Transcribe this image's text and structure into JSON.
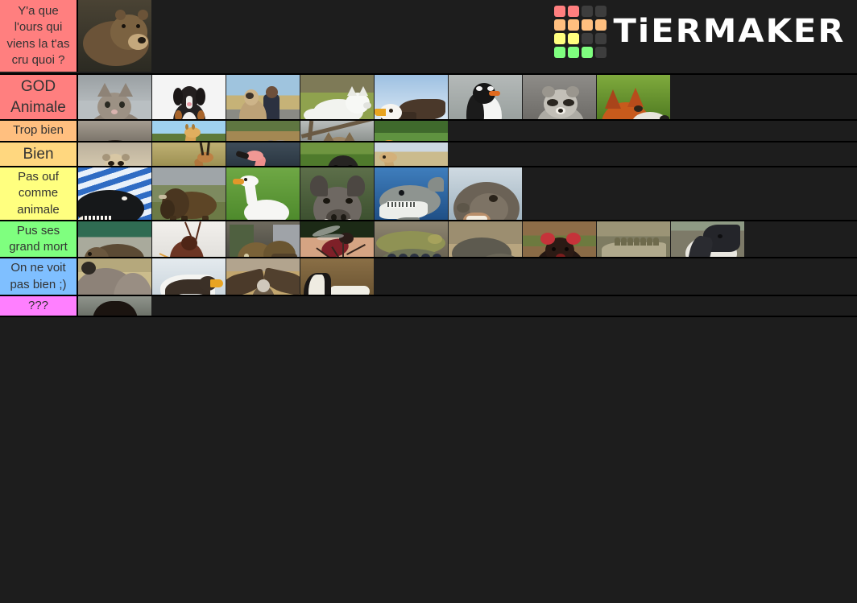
{
  "app": {
    "brand": "TiERMAKER",
    "background_color": "#1d1d1d",
    "logo_colors": {
      "red": "#ff7f7f",
      "orange": "#ffbf7f",
      "yellow": "#ffff7f",
      "green": "#7fff7f",
      "empty": "#3d3d3d"
    },
    "logo_pattern": [
      [
        "red",
        "red",
        "empty",
        "empty"
      ],
      [
        "orange",
        "orange",
        "orange",
        "orange"
      ],
      [
        "yellow",
        "yellow",
        "empty",
        "empty"
      ],
      [
        "green",
        "green",
        "green",
        "empty"
      ]
    ]
  },
  "tiers": [
    {
      "label": "Y'a que l'ours qui viens la t'as cru quoi ?",
      "color": "#ff7f7f",
      "label_size": "sm",
      "items": [
        {
          "name": "brown-bear",
          "kind": "bear"
        }
      ]
    },
    {
      "label": "GOD Animale",
      "color": "#ff7f7f",
      "label_size": "lg",
      "items": [
        {
          "name": "kitten",
          "kind": "cat"
        },
        {
          "name": "bernese-mountain-dog",
          "kind": "dog"
        },
        {
          "name": "kangal-dog-with-man",
          "kind": "kangal"
        },
        {
          "name": "arctic-wolf",
          "kind": "wolf"
        },
        {
          "name": "bald-eagle",
          "kind": "eagle"
        },
        {
          "name": "gentoo-penguin",
          "kind": "penguin"
        },
        {
          "name": "raccoon",
          "kind": "raccoon"
        },
        {
          "name": "red-fox",
          "kind": "fox"
        }
      ]
    },
    {
      "label": "Trop bien",
      "color": "#ffbf7f",
      "label_size": "md",
      "items": [
        {
          "name": "chimpanzee",
          "kind": "chimp"
        },
        {
          "name": "giraffe",
          "kind": "giraffe"
        },
        {
          "name": "elephant",
          "kind": "elephant"
        },
        {
          "name": "owl",
          "kind": "owl"
        },
        {
          "name": "tiger",
          "kind": "tiger"
        }
      ]
    },
    {
      "label": "Bien",
      "color": "#ffd77f",
      "label_size": "lg",
      "items": [
        {
          "name": "meerkat",
          "kind": "meerkat"
        },
        {
          "name": "gazelle",
          "kind": "gazelle"
        },
        {
          "name": "flamingo",
          "kind": "flamingo"
        },
        {
          "name": "gorilla",
          "kind": "gorilla"
        },
        {
          "name": "camel",
          "kind": "camel"
        }
      ]
    },
    {
      "label": "Pas ouf comme animale",
      "color": "#ffff7f",
      "label_size": "md",
      "items": [
        {
          "name": "orca",
          "kind": "orca"
        },
        {
          "name": "bison",
          "kind": "bison"
        },
        {
          "name": "goose",
          "kind": "goose"
        },
        {
          "name": "wild-boar",
          "kind": "boar"
        },
        {
          "name": "great-white-shark",
          "kind": "shark"
        },
        {
          "name": "sea-lion",
          "kind": "sealion"
        }
      ]
    },
    {
      "label": "Pus ses grand mort",
      "color": "#7fff7f",
      "label_size": "md",
      "items": [
        {
          "name": "nutria",
          "kind": "nutria"
        },
        {
          "name": "cockroach",
          "kind": "roach"
        },
        {
          "name": "snapping-turtle",
          "kind": "turtle"
        },
        {
          "name": "mosquito",
          "kind": "mosquito"
        },
        {
          "name": "anaconda",
          "kind": "anaconda"
        },
        {
          "name": "komodo-dragon",
          "kind": "komodo"
        },
        {
          "name": "tasmanian-devil",
          "kind": "devil"
        },
        {
          "name": "crocodile",
          "kind": "croc"
        },
        {
          "name": "anteater",
          "kind": "anteater"
        }
      ]
    },
    {
      "label": "On ne voit pas bien ;)",
      "color": "#7fbfff",
      "label_size": "md",
      "items": [
        {
          "name": "rhinoceros",
          "kind": "rhino"
        },
        {
          "name": "stellers-sea-eagle",
          "kind": "seaeagle"
        },
        {
          "name": "vulture",
          "kind": "vulture"
        },
        {
          "name": "skunk",
          "kind": "skunk"
        }
      ]
    },
    {
      "label": "???",
      "color": "#ff7fff",
      "label_size": "md",
      "items": [
        {
          "name": "man-portrait",
          "kind": "man"
        }
      ]
    }
  ]
}
